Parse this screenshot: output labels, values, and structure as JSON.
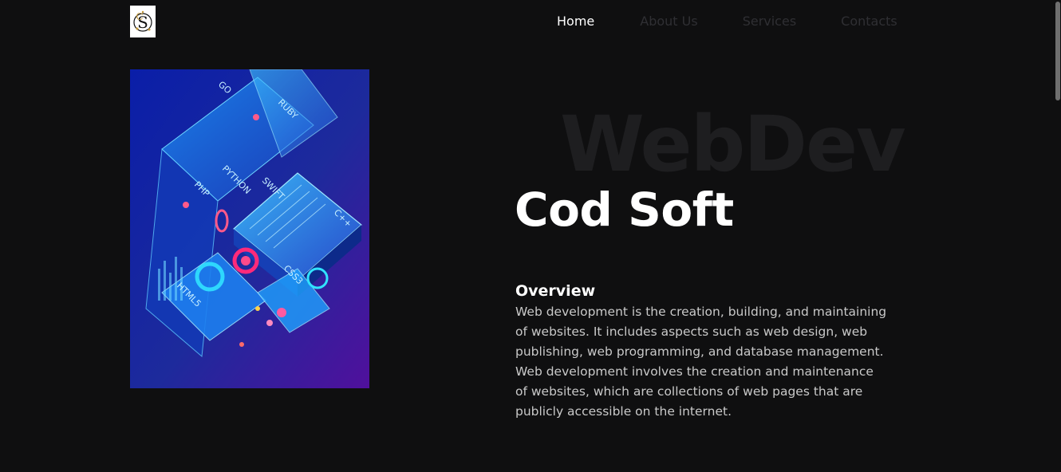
{
  "nav": {
    "logo_alt": "CS",
    "items": [
      {
        "label": "Home",
        "active": true
      },
      {
        "label": "About Us",
        "active": false
      },
      {
        "label": "Services",
        "active": false
      },
      {
        "label": "Contacts",
        "active": false
      }
    ]
  },
  "hero": {
    "watermark": "WebDev",
    "title": "Cod Soft",
    "image_labels": [
      "GO",
      "RUBY",
      "PYTHON",
      "SWIFT",
      "PHP",
      "C++",
      "HTML5",
      "CSS3"
    ]
  },
  "overview": {
    "heading": "Overview",
    "lines": [
      "Web development is the creation, building, and maintaining",
      "of websites. It includes aspects such as web design, web",
      "publishing, web programming, and database management.",
      "Web development involves the creation and maintenance",
      "of websites, which are collections of web pages that are",
      "publicly accessible on the internet."
    ]
  },
  "colors": {
    "background": "#0f0f10",
    "nav_inactive": "#2f2f33",
    "watermark": "#1e1e20",
    "body_text": "#c9c9c9",
    "accent_blue": "#1c8cff",
    "accent_purple": "#5a0fa0"
  }
}
